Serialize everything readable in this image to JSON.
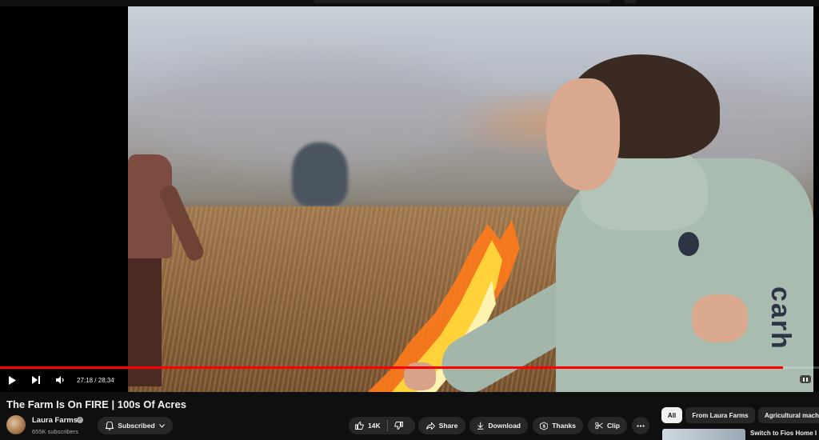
{
  "video": {
    "title": "The Farm Is On FIRE | 100s Of Acres",
    "current_time": "27:18",
    "duration": "28:34",
    "time_display": "27:18 / 28:34",
    "progress_fraction": 0.956,
    "sleeve_print": "carh"
  },
  "channel": {
    "name": "Laura Farms",
    "subscribers": "655K subscribers",
    "subscribe_label": "Subscribed"
  },
  "actions": {
    "like_count": "14K",
    "share_label": "Share",
    "download_label": "Download",
    "thanks_label": "Thanks",
    "clip_label": "Clip"
  },
  "chips": [
    "All",
    "From Laura Farms",
    "Agricultural mach"
  ],
  "recommendation": {
    "title": "Switch to Fios Home I"
  },
  "colors": {
    "progress": "#ff0000",
    "background": "#0f0f0f",
    "pill": "#272727"
  }
}
